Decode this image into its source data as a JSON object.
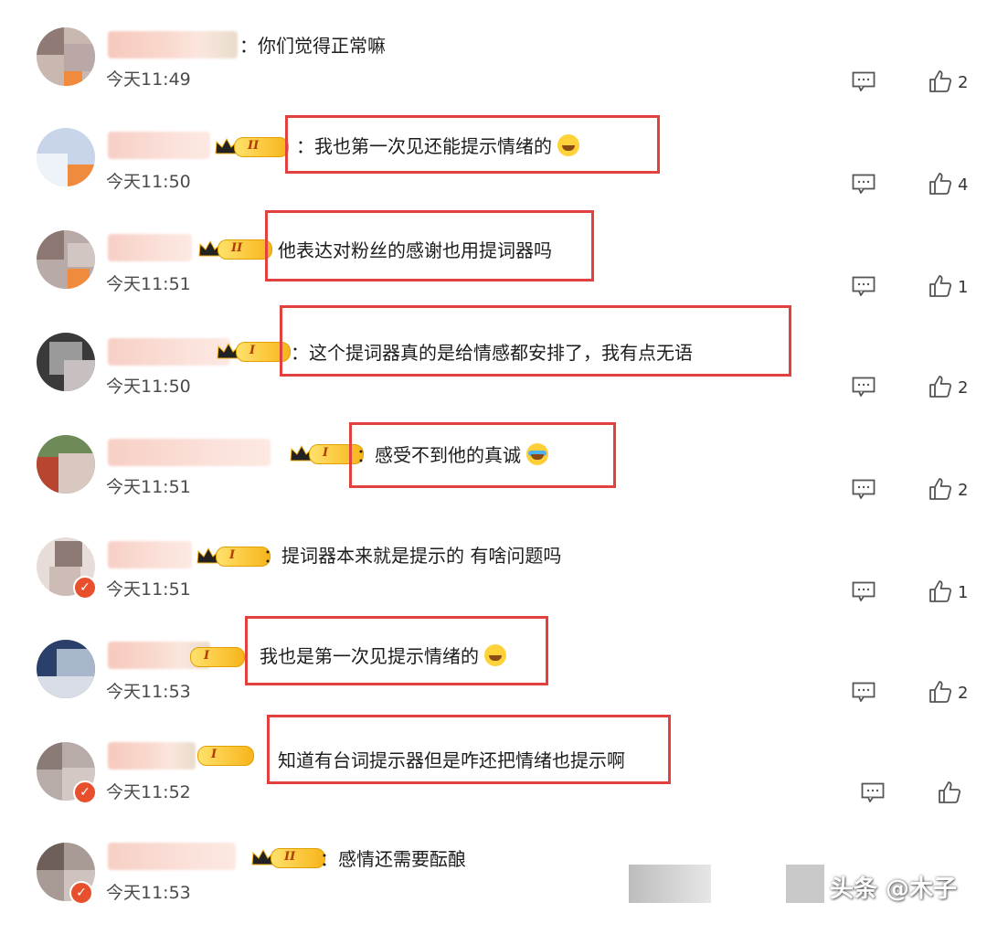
{
  "comments": [
    {
      "text": "：你们觉得正常嘛",
      "time": "今天11:49",
      "likes": "2",
      "emoji": ""
    },
    {
      "text": "：我也第一次见还能提示情绪的",
      "time": "今天11:50",
      "likes": "4",
      "emoji": "laugh-cry"
    },
    {
      "text": "他表达对粉丝的感谢也用提词器吗",
      "time": "今天11:51",
      "likes": "1",
      "emoji": ""
    },
    {
      "text": "：这个提词器真的是给情感都安排了，我有点无语",
      "time": "今天11:50",
      "likes": "2",
      "emoji": ""
    },
    {
      "text": "：感受不到他的真诚",
      "time": "今天11:51",
      "likes": "2",
      "emoji": "crying"
    },
    {
      "text": "：提词器本来就是提示的 有啥问题吗",
      "time": "今天11:51",
      "likes": "1",
      "emoji": ""
    },
    {
      "text": "我也是第一次见提示情绪的",
      "time": "今天11:53",
      "likes": "2",
      "emoji": "laugh-cry"
    },
    {
      "text": "知道有台词提示器但是咋还把情绪也提示啊",
      "time": "今天11:52",
      "likes": "",
      "emoji": ""
    },
    {
      "text": "：感情还需要酝酿",
      "time": "今天11:53",
      "likes": "",
      "emoji": ""
    }
  ],
  "rank_labels": [
    "II",
    "II",
    "I",
    "I",
    "I",
    "I",
    "I",
    "II"
  ],
  "watermark": {
    "text": "头条 @木子"
  },
  "colors": {
    "highlight": "#e2423f",
    "rank_gold": "#f8b41b",
    "text": "#1d1d1d",
    "time": "#4a4a4a"
  }
}
